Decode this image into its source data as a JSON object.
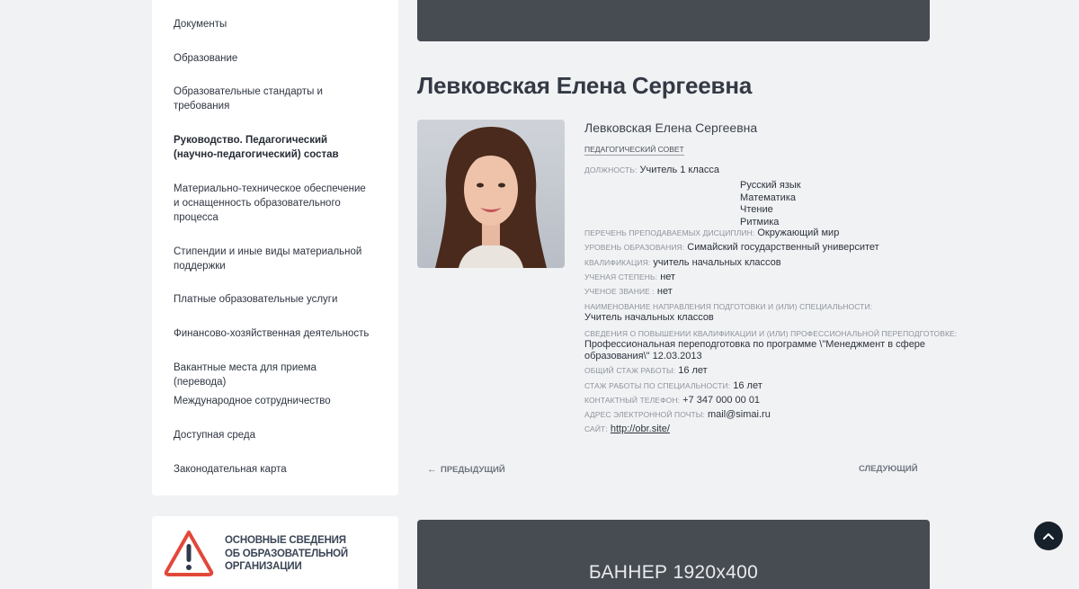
{
  "sidebar": {
    "items": [
      {
        "label": "Документы"
      },
      {
        "label": "Образование"
      },
      {
        "label": "Образовательные стандарты и требования"
      },
      {
        "label": "Руководство. Педагогический (научно-педагогический) состав",
        "active": true
      },
      {
        "label": "Материально-техническое обеспечение и оснащенность образовательного процесса"
      },
      {
        "label": "Стипендии и иные виды материальной поддержки"
      },
      {
        "label": "Платные образовательные услуги"
      },
      {
        "label": "Финансово-хозяйственная деятельность"
      },
      {
        "label": "Вакантные места для приема (перевода)"
      },
      {
        "label": "Международное сотрудничество"
      },
      {
        "label": "Доступная среда"
      },
      {
        "label": "Законодательная карта"
      }
    ]
  },
  "notice": {
    "line1": "Основные сведения",
    "line2": "об образовательной",
    "line3": "организации",
    "icon": "warning-triangle-icon",
    "accent_color": "#e2483a"
  },
  "title": "Левковская Елена Сергеевна",
  "profile": {
    "name": "Левковская Елена Сергеевна",
    "tag": "Педагогический совет",
    "position_label": "Должность:",
    "position": "Учитель 1 класса",
    "disciplines": [
      "Русский язык",
      "Математика",
      "Чтение",
      "Ритмика",
      "Окружающий мир"
    ],
    "disciplines_label": "Перечень преподаваемых дисциплин:",
    "education_label": "Уровень образования:",
    "education": "Симайский государственный университет",
    "qualification_label": "Квалификация:",
    "qualification": "учитель начальных классов",
    "degree_label": "Ученая степень:",
    "degree": "нет",
    "rank_label": "Ученое звание :",
    "rank": "нет",
    "speciality_label": "Наименование направления подготовки и (или) специальности:",
    "speciality": "Учитель начальных классов",
    "training_label": "Сведения о повышении квалификации и (или) профессиональной переподготовке:",
    "training_line1": "Профессиональная переподготовка по программе \\\"Менеджмент в сфере",
    "training_line2": "образования\\\" 12.03.2013",
    "total_exp_label": "Общий стаж работы:",
    "total_exp": "16 лет",
    "spec_exp_label": "Стаж работы по специальности:",
    "spec_exp": "16 лет",
    "phone_label": "Контактный телефон:",
    "phone": "+7 347 000 00 01",
    "email_label": "Адрес электронной почты:",
    "email": "mail@simai.ru",
    "site_label": "Сайт:",
    "site": "http://obr.site/"
  },
  "pager": {
    "prev": "Предыдущий",
    "next": "Следующий"
  },
  "banner": {
    "text": "БАННЕР 1920x400",
    "color": "#474c53"
  },
  "scroll_top": {
    "icon": "chevron-up-icon"
  }
}
